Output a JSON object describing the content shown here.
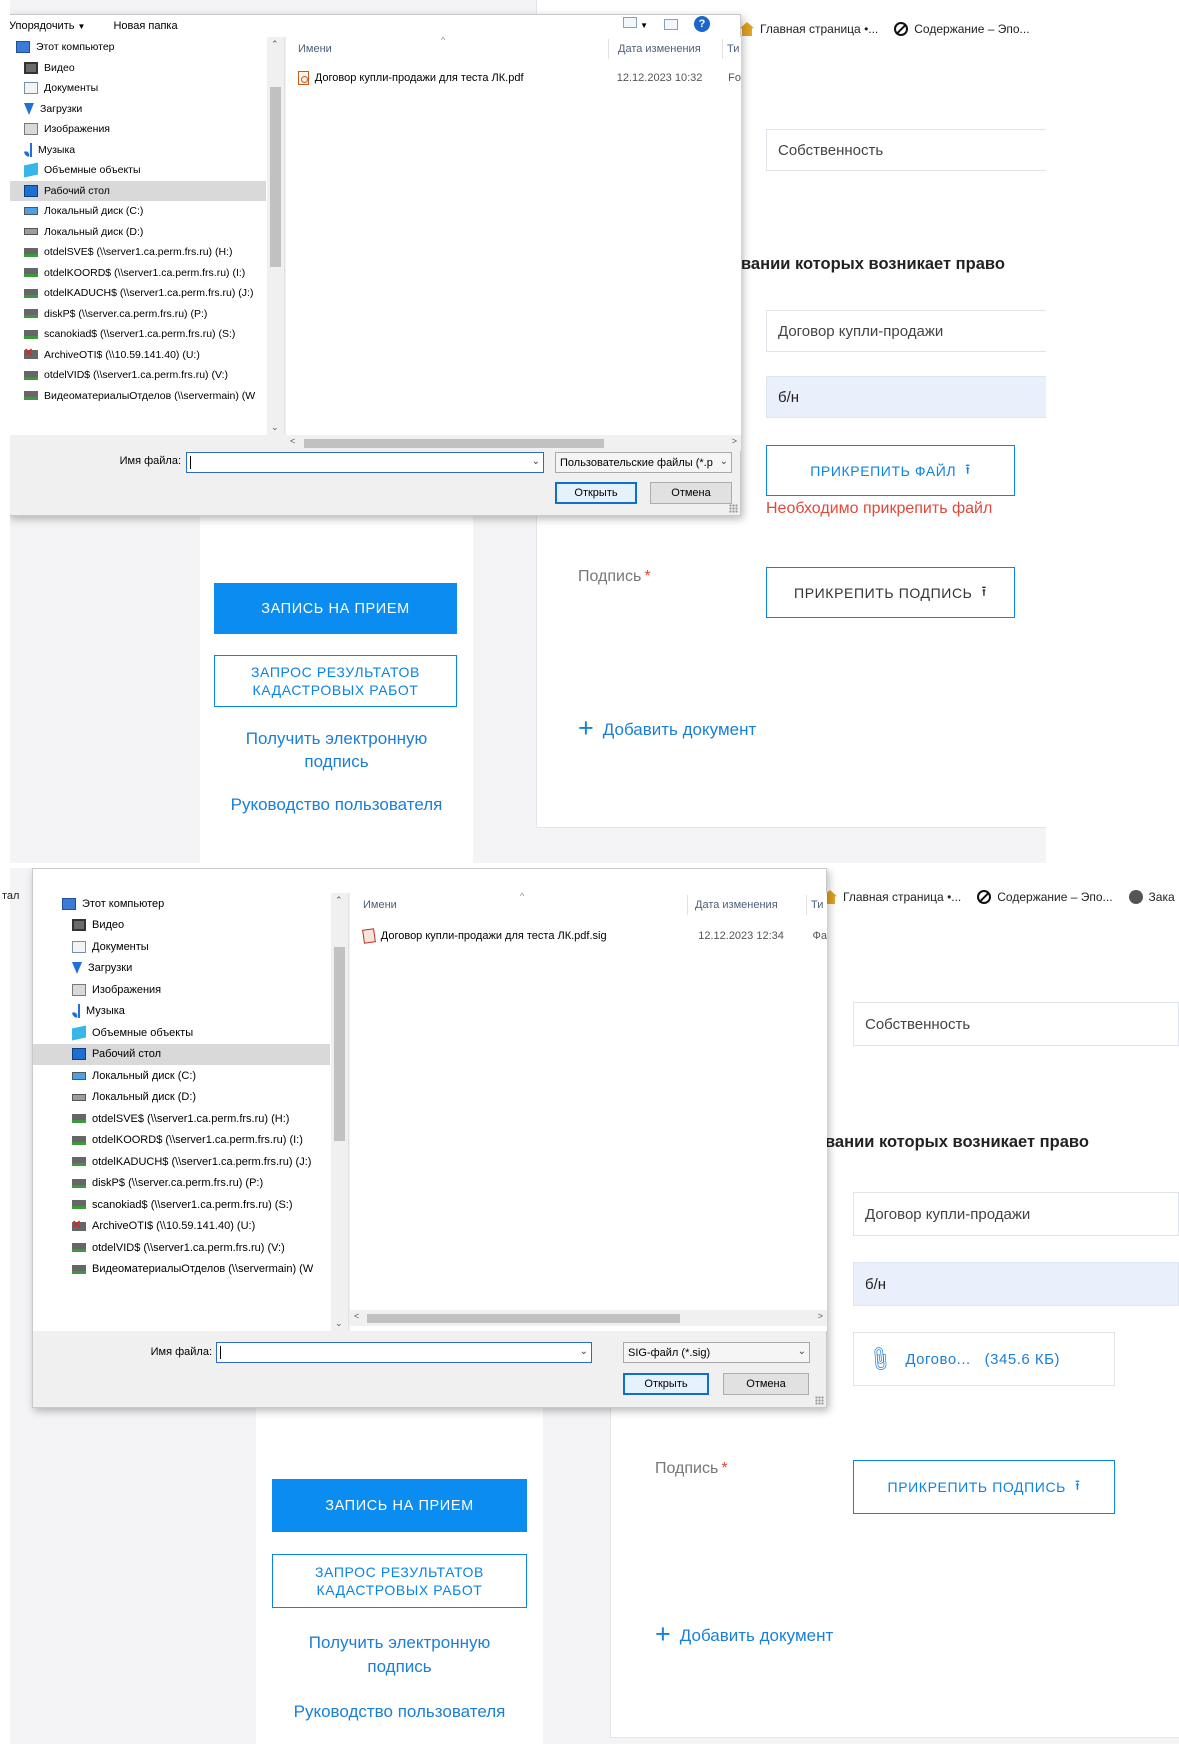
{
  "browser": {
    "tabs_top": [
      "Главная страница •...",
      "Содержание – Эпо..."
    ],
    "tabs_bottom": [
      "Главная страница •...",
      "Содержание – Эпо...",
      "Зака"
    ]
  },
  "page": {
    "ownership_field": "Собственность",
    "basis_heading": "вании которых возникает право",
    "doc_type_field": "Договор купли-продажи",
    "doc_number_field": "б/н",
    "attach_file_button": "ПРИКРЕПИТЬ ФАЙЛ",
    "attach_file_error": "Необходимо прикрепить файл",
    "signature_label": "Подпись",
    "signature_required_mark": "*",
    "attach_signature_button": "ПРИКРЕПИТЬ ПОДПИСЬ",
    "add_document_link": "Добавить документ",
    "attached_file_name": "Догово...",
    "attached_file_size": "(345.6 КБ)",
    "left_nav": {
      "appointment_button": "ЗАПИСЬ НА ПРИЕМ",
      "cadastral_button_line1": "ЗАПРОС РЕЗУЛЬТАТОВ",
      "cadastral_button_line2": "КАДАСТРОВЫХ РАБОТ",
      "esign_link_line1": "Получить электронную",
      "esign_link_line2": "подпись",
      "manual_link": "Руководство пользователя"
    },
    "cut_off_left_text": "тал"
  },
  "dialog": {
    "toolbar_organize": "Упорядочить",
    "toolbar_new_folder": "Новая папка",
    "nav_items": [
      {
        "label": "Этот компьютер",
        "icon": "computer-icon"
      },
      {
        "label": "Видео",
        "icon": "video-folder-icon"
      },
      {
        "label": "Документы",
        "icon": "documents-folder-icon"
      },
      {
        "label": "Загрузки",
        "icon": "downloads-folder-icon"
      },
      {
        "label": "Изображения",
        "icon": "pictures-folder-icon"
      },
      {
        "label": "Музыка",
        "icon": "music-folder-icon"
      },
      {
        "label": "Объемные объекты",
        "icon": "3d-objects-icon"
      },
      {
        "label": "Рабочий стол",
        "icon": "desktop-folder-icon"
      },
      {
        "label": "Локальный диск (C:)",
        "icon": "drive-c-icon"
      },
      {
        "label": "Локальный диск (D:)",
        "icon": "drive-icon"
      },
      {
        "label": "otdelSVE$ (\\\\server1.ca.perm.frs.ru) (H:)",
        "icon": "network-drive-icon"
      },
      {
        "label": "otdelKOORD$ (\\\\server1.ca.perm.frs.ru) (I:)",
        "icon": "network-drive-icon"
      },
      {
        "label": "otdelKADUCH$ (\\\\server1.ca.perm.frs.ru) (J:)",
        "icon": "network-drive-icon"
      },
      {
        "label": "diskP$ (\\\\server.ca.perm.frs.ru) (P:)",
        "icon": "network-drive-icon"
      },
      {
        "label": "scanokiad$ (\\\\server1.ca.perm.frs.ru) (S:)",
        "icon": "network-drive-icon"
      },
      {
        "label": "ArchiveOTI$ (\\\\10.59.141.40) (U:)",
        "icon": "disconnected-drive-icon"
      },
      {
        "label": "otdelVID$ (\\\\server1.ca.perm.frs.ru) (V:)",
        "icon": "network-drive-icon"
      },
      {
        "label": "ВидеоматериалыОтделов (\\\\servermain) (W",
        "icon": "network-drive-icon"
      }
    ],
    "columns": {
      "name": "Имени",
      "date": "Дата изменения",
      "type_top": "Ти",
      "type_bottom": "Ти"
    },
    "file_label": "Имя файла:",
    "open_button": "Открыть",
    "cancel_button": "Отмена",
    "top": {
      "file_name": "Договор купли-продажи для теста ЛК.pdf",
      "file_date": "12.12.2023 10:32",
      "file_type": "Fo",
      "filter": "Пользовательские файлы (*.p"
    },
    "bottom": {
      "file_name": "Договор купли-продажи для теста ЛК.pdf.sig",
      "file_date": "12.12.2023 12:34",
      "file_type": "Фа",
      "filter": "SIG-файл (*.sig)"
    }
  }
}
